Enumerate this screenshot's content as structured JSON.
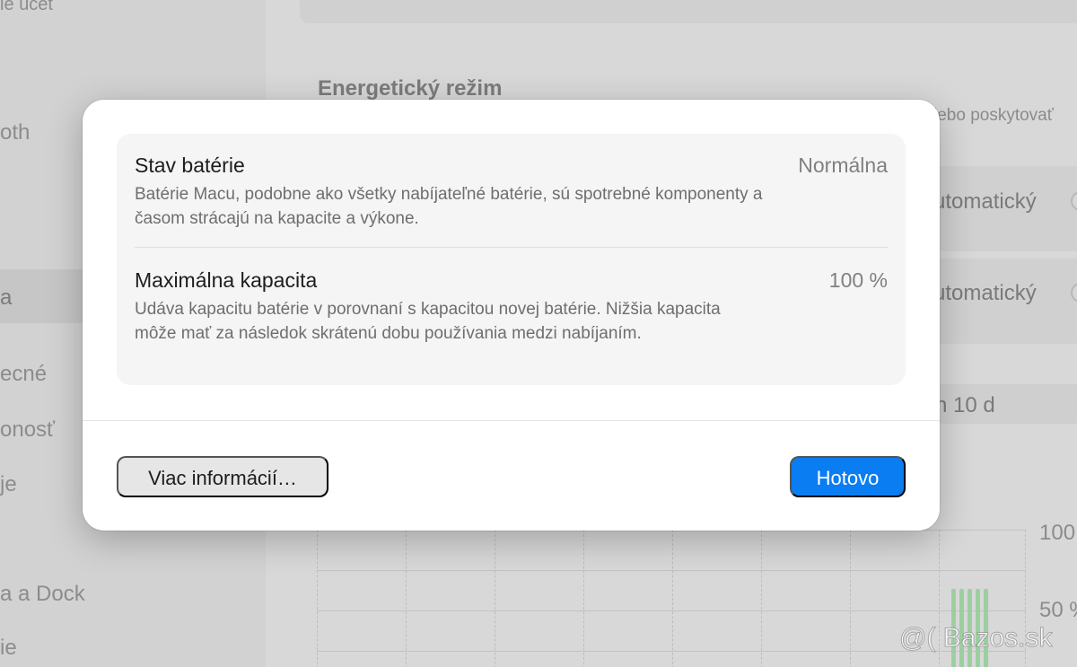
{
  "background": {
    "sidebar_items": [
      "ie účet",
      "oth",
      "a",
      "ecné",
      "onosť",
      "je",
      "a a Dock",
      "ie"
    ],
    "section_title": "Energetický režim",
    "section_desc_fragment": "lebo poskytovať",
    "mode_values": [
      "utomatický",
      "utomatický"
    ],
    "chart_header_fragment": "n 10 d",
    "chart_tick_labels": [
      "100",
      "50 %"
    ]
  },
  "dialog": {
    "battery_state": {
      "title": "Stav batérie",
      "value": "Normálna",
      "description": "Batérie Macu, podobne ako všetky nabíjateľné batérie, sú spotrebné komponenty a časom strácajú na kapacite a výkone."
    },
    "max_capacity": {
      "title": "Maximálna kapacita",
      "value": "100 %",
      "description": "Udáva kapacitu batérie v porovnaní s kapacitou novej batérie. Nižšia kapacita môže mať za následok skrátenú dobu používania medzi nabíjaním."
    },
    "more_info_label": "Viac informácií…",
    "done_label": "Hotovo"
  },
  "watermark": "@( Bazos.sk",
  "colors": {
    "accent": "#0a7df2",
    "chart_bar": "#9ccf9f"
  }
}
